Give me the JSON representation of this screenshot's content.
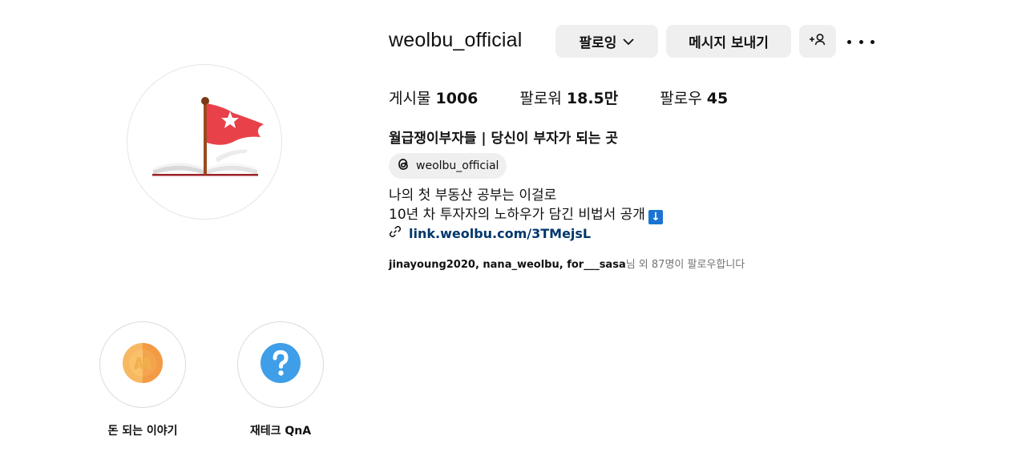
{
  "profile": {
    "username": "weolbu_official",
    "full_name": "월급쟁이부자들 | 당신이 부자가 되는 곳",
    "threads_handle": "weolbu_official",
    "bio_lines": [
      "나의 첫 부동산 공부는 이걸로",
      "10년 차 투자자의 노하우가 담긴 비법서 공개"
    ],
    "bio_emoji": "↓",
    "link": "link.weolbu.com/3TMejsL",
    "followed_by_names": "jinayoung2020, nana_weolbu, for___sasa",
    "followed_by_suffix": "님 외 87명이 팔로우합니다"
  },
  "actions": {
    "follow_label": "팔로잉",
    "message_label": "메시지 보내기",
    "add_user_icon": "add-user-icon",
    "more_icon": "more-icon"
  },
  "stats": {
    "posts_label": "게시물",
    "posts_value": "1006",
    "followers_label": "팔로워",
    "followers_value": "18.5만",
    "following_label": "팔로우",
    "following_value": "45"
  },
  "highlights": [
    {
      "label": "돈 되는 이야기",
      "icon": "coin-icon"
    },
    {
      "label": "재테크 QnA",
      "icon": "question-icon"
    }
  ],
  "colors": {
    "link": "#00376b",
    "button_bg": "#efefef",
    "muted_text": "#737373",
    "flag_red": "#e8414a",
    "question_blue": "#3e9ee8",
    "coin_orange": "#f6a94a"
  }
}
